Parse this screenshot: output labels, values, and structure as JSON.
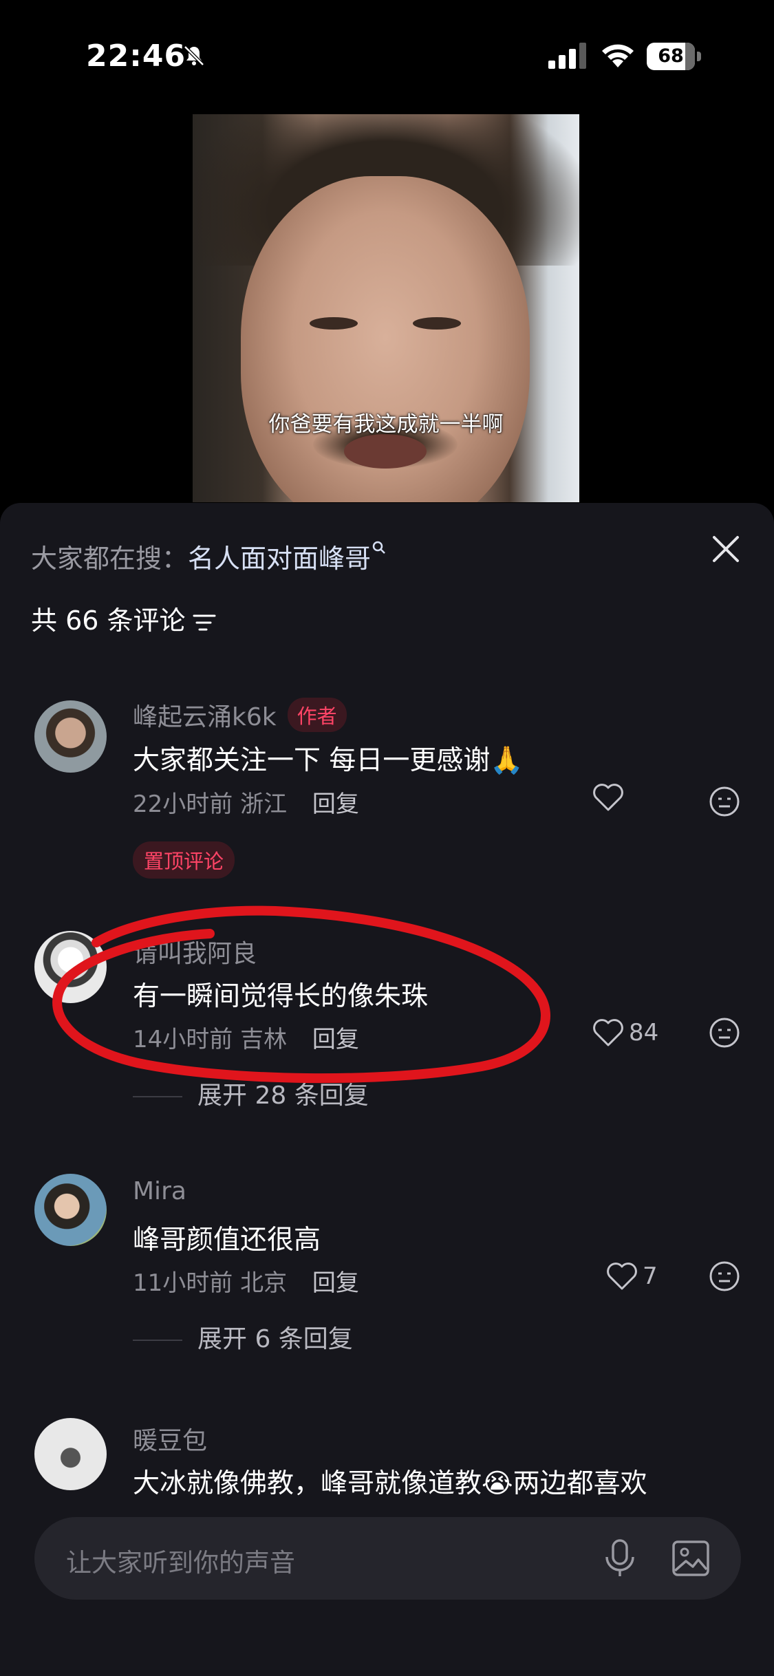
{
  "status_bar": {
    "time": "22:46",
    "battery": "68",
    "icons": [
      "bell-off-icon",
      "cellular-signal-icon",
      "wifi-icon",
      "battery-icon"
    ]
  },
  "video": {
    "subtitle": "你爸要有我这成就一半啊"
  },
  "sheet": {
    "search_prefix": "大家都在搜：",
    "search_term": "名人面对面峰哥",
    "comment_count_label": "共 66 条评论",
    "close_icon": "close-icon",
    "filter_icon": "filter-icon"
  },
  "comments": [
    {
      "name": "峰起云涌k6k",
      "author_badge": "作者",
      "text": "大家都关注一下 每日一更感谢🙏",
      "time": "22小时前",
      "location": "浙江",
      "reply": "回复",
      "likes": "",
      "pinned": "置顶评论",
      "expand": ""
    },
    {
      "name": "请叫我阿良",
      "text": "有一瞬间觉得长的像朱珠",
      "time": "14小时前",
      "location": "吉林",
      "reply": "回复",
      "likes": "84",
      "expand": "展开 28 条回复"
    },
    {
      "name": "Mira",
      "text": "峰哥颜值还很高",
      "time": "11小时前",
      "location": "北京",
      "reply": "回复",
      "likes": "7",
      "expand": "展开 6 条回复"
    },
    {
      "name": "暖豆包",
      "text": "大冰就像佛教，峰哥就像道教😭两边都喜欢"
    }
  ],
  "input": {
    "placeholder": "让大家听到你的声音",
    "mic_icon": "microphone-icon",
    "image_icon": "image-icon"
  },
  "colors": {
    "sheet_bg": "#16161c",
    "accent_red": "#ff4466",
    "annotation_red": "#e0151c"
  }
}
